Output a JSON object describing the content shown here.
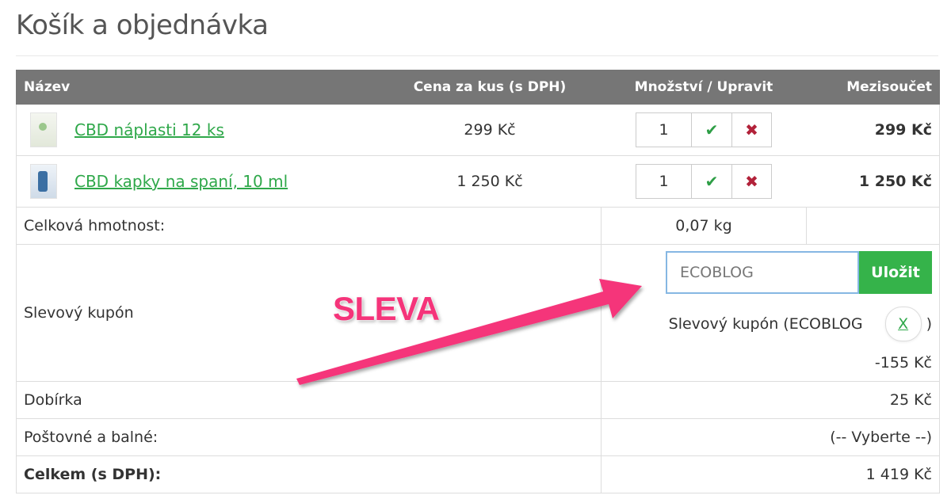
{
  "page": {
    "title": "Košík a objednávka"
  },
  "table": {
    "headers": {
      "name": "Název",
      "price": "Cena za kus (s DPH)",
      "qty": "Množství / Upravit",
      "subtotal": "Mezisoučet"
    },
    "items": [
      {
        "name": "CBD náplasti 12 ks",
        "price": "299 Kč",
        "qty": "1",
        "subtotal": "299 Kč",
        "thumb_icon": "patch-box-thumbnail"
      },
      {
        "name": "CBD kapky na spaní, 10 ml",
        "price": "1 250 Kč",
        "qty": "1",
        "subtotal": "1 250 Kč",
        "thumb_icon": "drops-box-thumbnail"
      }
    ],
    "update_icon": "check-icon",
    "remove_icon": "cross-icon"
  },
  "weight": {
    "label": "Celková hmotnost:",
    "value": "0,07 kg"
  },
  "coupon": {
    "label": "Slevový kupón",
    "input_value": "ECOBLOG",
    "save_label": "Uložit",
    "applied_prefix": "Slevový kupón (ECOBLOG",
    "remove_label": "X",
    "applied_suffix": ")",
    "discount": "-155 Kč"
  },
  "cod": {
    "label": "Dobírka",
    "value": "25 Kč"
  },
  "shipping": {
    "label": "Poštovné a balné:",
    "value": "(-- Vyberte --)"
  },
  "total": {
    "label": "Celkem (s DPH):",
    "value": "1 419 Kč"
  },
  "annotation": {
    "text": "SLEVA",
    "color": "#f5347a"
  },
  "colors": {
    "header_bg": "#767676",
    "link": "#2fa84a",
    "save": "#35b34a",
    "remove": "#b2223a"
  }
}
